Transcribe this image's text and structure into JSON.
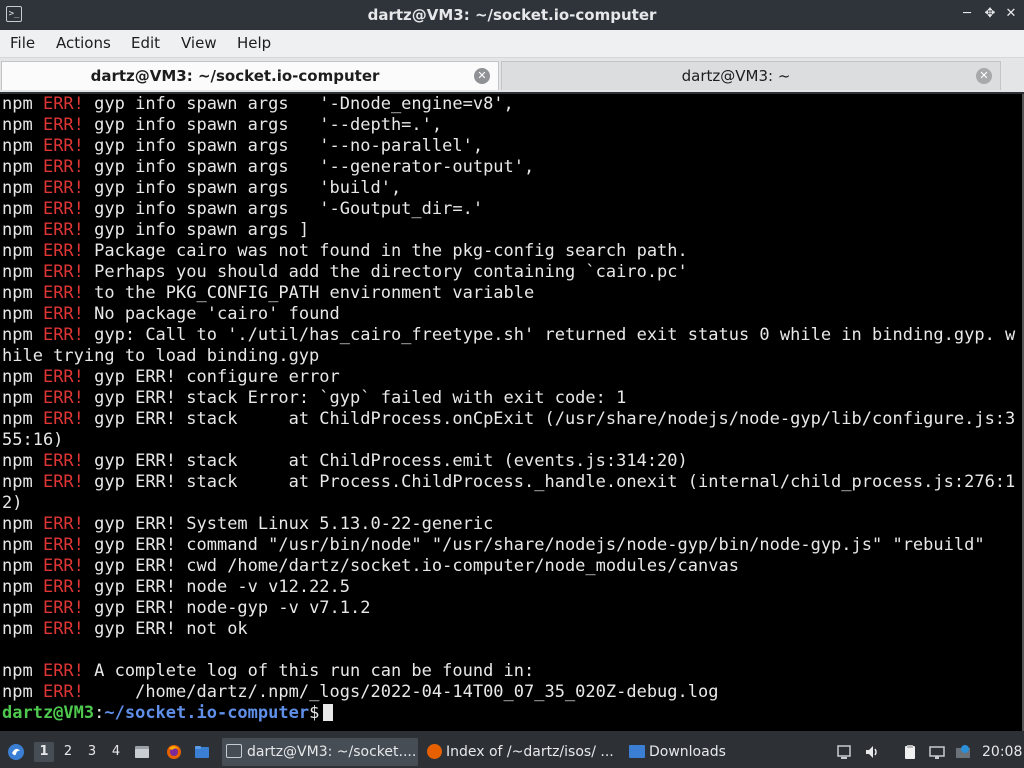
{
  "window": {
    "title": "dartz@VM3: ~/socket.io-computer",
    "icon": "terminal-icon",
    "buttons": {
      "minimize": "_",
      "maximize": "✕",
      "close": "✕"
    }
  },
  "menubar": [
    "File",
    "Actions",
    "Edit",
    "View",
    "Help"
  ],
  "tabs": [
    {
      "label": "dartz@VM3: ~/socket.io-computer",
      "active": true
    },
    {
      "label": "dartz@VM3: ~",
      "active": false
    }
  ],
  "terminal": {
    "lines": [
      {
        "pre": "npm ",
        "err": "ERR!",
        "text": " gyp info spawn args   '-Dnode_engine=v8',"
      },
      {
        "pre": "npm ",
        "err": "ERR!",
        "text": " gyp info spawn args   '--depth=.',"
      },
      {
        "pre": "npm ",
        "err": "ERR!",
        "text": " gyp info spawn args   '--no-parallel',"
      },
      {
        "pre": "npm ",
        "err": "ERR!",
        "text": " gyp info spawn args   '--generator-output',"
      },
      {
        "pre": "npm ",
        "err": "ERR!",
        "text": " gyp info spawn args   'build',"
      },
      {
        "pre": "npm ",
        "err": "ERR!",
        "text": " gyp info spawn args   '-Goutput_dir=.'"
      },
      {
        "pre": "npm ",
        "err": "ERR!",
        "text": " gyp info spawn args ]"
      },
      {
        "pre": "npm ",
        "err": "ERR!",
        "text": " Package cairo was not found in the pkg-config search path."
      },
      {
        "pre": "npm ",
        "err": "ERR!",
        "text": " Perhaps you should add the directory containing `cairo.pc'"
      },
      {
        "pre": "npm ",
        "err": "ERR!",
        "text": " to the PKG_CONFIG_PATH environment variable"
      },
      {
        "pre": "npm ",
        "err": "ERR!",
        "text": " No package 'cairo' found"
      },
      {
        "pre": "npm ",
        "err": "ERR!",
        "text": " gyp: Call to './util/has_cairo_freetype.sh' returned exit status 0 while in binding.gyp. w"
      },
      {
        "pre": "hile trying to load binding.gyp",
        "err": "",
        "text": ""
      },
      {
        "pre": "npm ",
        "err": "ERR!",
        "text": " gyp ERR! configure error"
      },
      {
        "pre": "npm ",
        "err": "ERR!",
        "text": " gyp ERR! stack Error: `gyp` failed with exit code: 1"
      },
      {
        "pre": "npm ",
        "err": "ERR!",
        "text": " gyp ERR! stack     at ChildProcess.onCpExit (/usr/share/nodejs/node-gyp/lib/configure.js:3"
      },
      {
        "pre": "55:16)",
        "err": "",
        "text": ""
      },
      {
        "pre": "npm ",
        "err": "ERR!",
        "text": " gyp ERR! stack     at ChildProcess.emit (events.js:314:20)"
      },
      {
        "pre": "npm ",
        "err": "ERR!",
        "text": " gyp ERR! stack     at Process.ChildProcess._handle.onexit (internal/child_process.js:276:1"
      },
      {
        "pre": "2)",
        "err": "",
        "text": ""
      },
      {
        "pre": "npm ",
        "err": "ERR!",
        "text": " gyp ERR! System Linux 5.13.0-22-generic"
      },
      {
        "pre": "npm ",
        "err": "ERR!",
        "text": " gyp ERR! command \"/usr/bin/node\" \"/usr/share/nodejs/node-gyp/bin/node-gyp.js\" \"rebuild\""
      },
      {
        "pre": "npm ",
        "err": "ERR!",
        "text": " gyp ERR! cwd /home/dartz/socket.io-computer/node_modules/canvas"
      },
      {
        "pre": "npm ",
        "err": "ERR!",
        "text": " gyp ERR! node -v v12.22.5"
      },
      {
        "pre": "npm ",
        "err": "ERR!",
        "text": " gyp ERR! node-gyp -v v7.1.2"
      },
      {
        "pre": "npm ",
        "err": "ERR!",
        "text": " gyp ERR! not ok"
      },
      {
        "pre": "",
        "err": "",
        "text": ""
      },
      {
        "pre": "npm ",
        "err": "ERR!",
        "text": " A complete log of this run can be found in:"
      },
      {
        "pre": "npm ",
        "err": "ERR!",
        "text": "     /home/dartz/.npm/_logs/2022-04-14T00_07_35_020Z-debug.log"
      }
    ],
    "prompt": {
      "user_host": "dartz@VM3",
      "sep": ":",
      "path": "~/socket.io-computer",
      "symbol": "$"
    }
  },
  "taskbar": {
    "workspaces": [
      "1",
      "2",
      "3",
      "4"
    ],
    "active_workspace": "1",
    "launchers": [
      "files-icon",
      "firefox-icon",
      "folder-icon"
    ],
    "tasks": [
      {
        "label": "dartz@VM3: ~/socket....",
        "icon": "terminal-icon",
        "active": true
      },
      {
        "label": "Index of /~dartz/isos/ ...",
        "icon": "firefox-icon",
        "active": false
      },
      {
        "label": "Downloads",
        "icon": "folder-icon",
        "active": false
      }
    ],
    "tray": [
      "screen-icon",
      "volume-icon",
      "clipboard-icon",
      "network-icon",
      "update-icon"
    ],
    "clock": "20:08"
  },
  "colors": {
    "terminal_bg": "#000000",
    "error_red": "#e03535",
    "prompt_green": "#4ec94e",
    "prompt_blue": "#5f8fe8",
    "panel_bg": "#2d3136"
  }
}
